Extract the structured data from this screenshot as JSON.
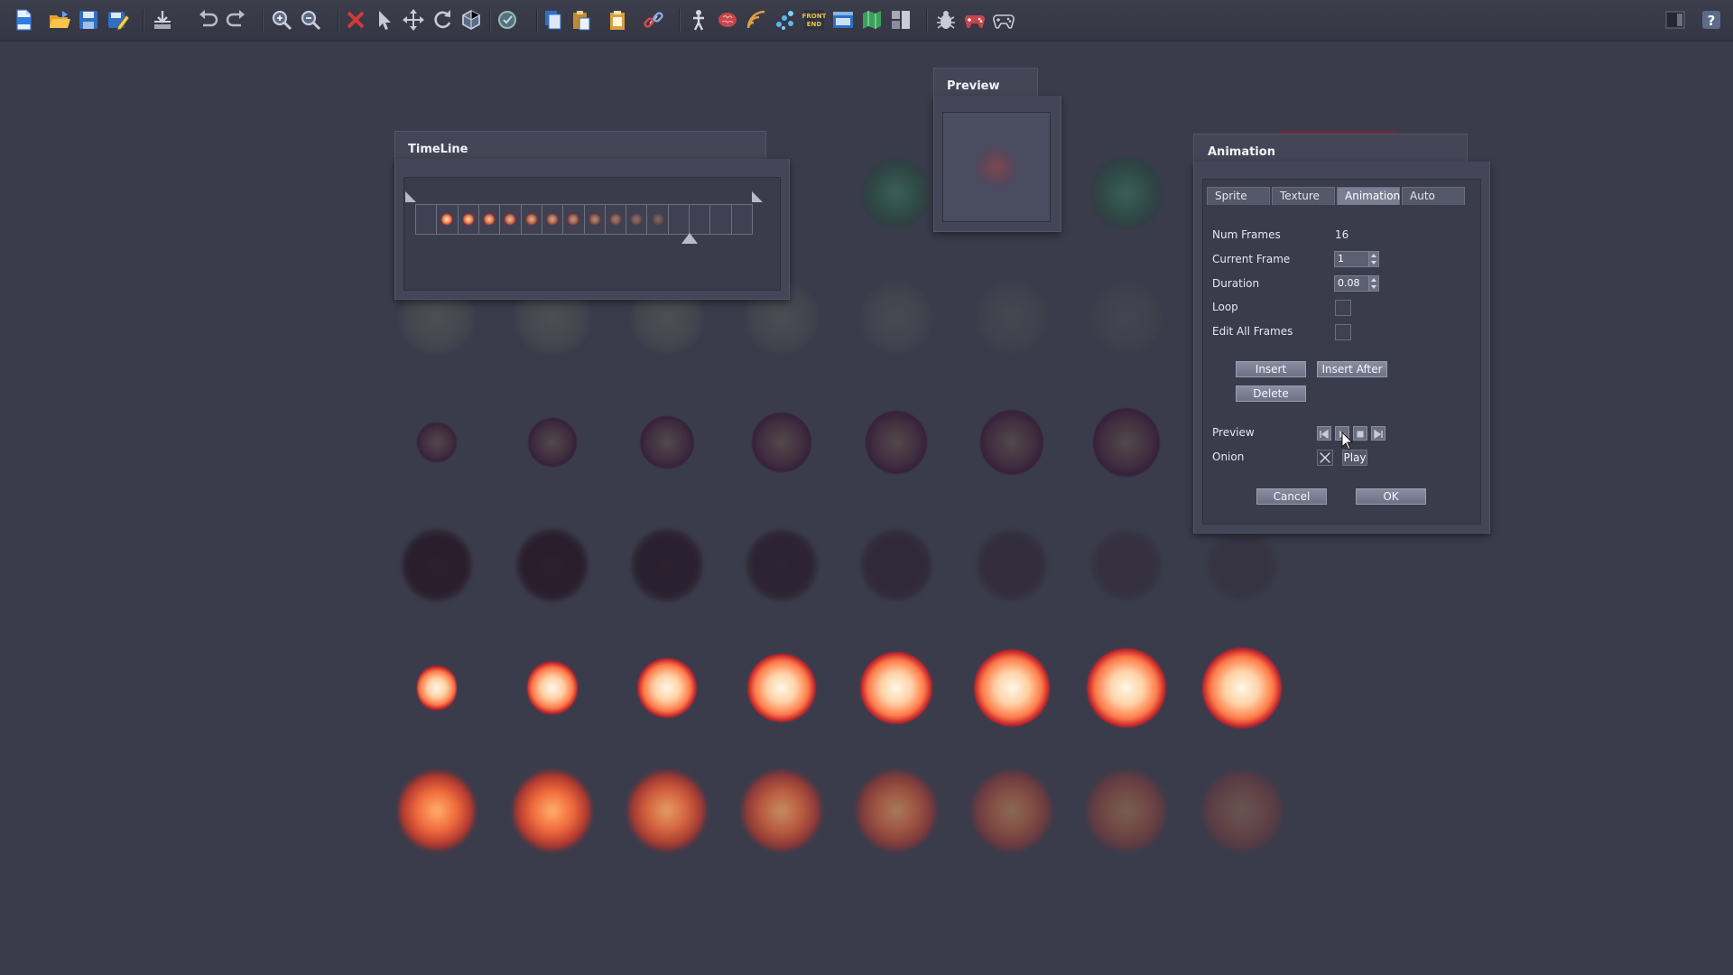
{
  "toolbar": {
    "icons": [
      "new-file-icon",
      "open-folder-icon",
      "save-icon",
      "save-as-icon",
      "import-icon",
      "undo-icon",
      "redo-icon",
      "zoom-in-icon",
      "zoom-out-icon",
      "delete-icon",
      "select-arrow-icon",
      "move-icon",
      "rotate-icon",
      "scale-icon",
      "snap-icon",
      "copy-icon",
      "paste-icon",
      "clipboard-icon",
      "link-icon",
      "character-icon",
      "brain-icon",
      "wifi-signal-icon",
      "particles-icon",
      "front-end-icon",
      "window-icon",
      "map-icon",
      "layout-icon",
      "bug-icon",
      "gamepad-red-icon",
      "gamepad-icon",
      "panel-toggle-icon",
      "help-icon"
    ],
    "front_end_text": "FRONT END"
  },
  "timeline": {
    "title": "TimeLine",
    "frame_count": 16,
    "filled_frames": 11,
    "current_frame_marker": 13
  },
  "preview": {
    "title": "Preview"
  },
  "animation": {
    "title": "Animation",
    "tabs": [
      {
        "label": "Sprite",
        "active": false
      },
      {
        "label": "Texture",
        "active": false
      },
      {
        "label": "Animation",
        "active": true
      },
      {
        "label": "Auto",
        "active": false
      }
    ],
    "num_frames_label": "Num Frames",
    "num_frames_value": "16",
    "current_frame_label": "Current Frame",
    "current_frame_value": "1",
    "duration_label": "Duration",
    "duration_value": "0.08",
    "loop_label": "Loop",
    "loop_checked": false,
    "edit_all_label": "Edit All Frames",
    "edit_all_checked": false,
    "insert_label": "Insert",
    "insert_after_label": "Insert After",
    "delete_label": "Delete",
    "preview_label": "Preview",
    "onion_label": "Onion",
    "onion_checked": true,
    "play_label": "Play",
    "cancel_label": "Cancel",
    "ok_label": "OK"
  },
  "sprite_sheet": {
    "rows": [
      {
        "kind": "cloud",
        "count": 7
      },
      {
        "kind": "smoke",
        "count": 7
      },
      {
        "kind": "purple",
        "count": 7
      },
      {
        "kind": "dark",
        "count": 8
      },
      {
        "kind": "fire",
        "count": 8
      },
      {
        "kind": "burn",
        "count": 8
      }
    ]
  },
  "colors": {
    "background": "#3b3c4b",
    "panel": "#444657",
    "active_tab": "#7b7e92"
  }
}
